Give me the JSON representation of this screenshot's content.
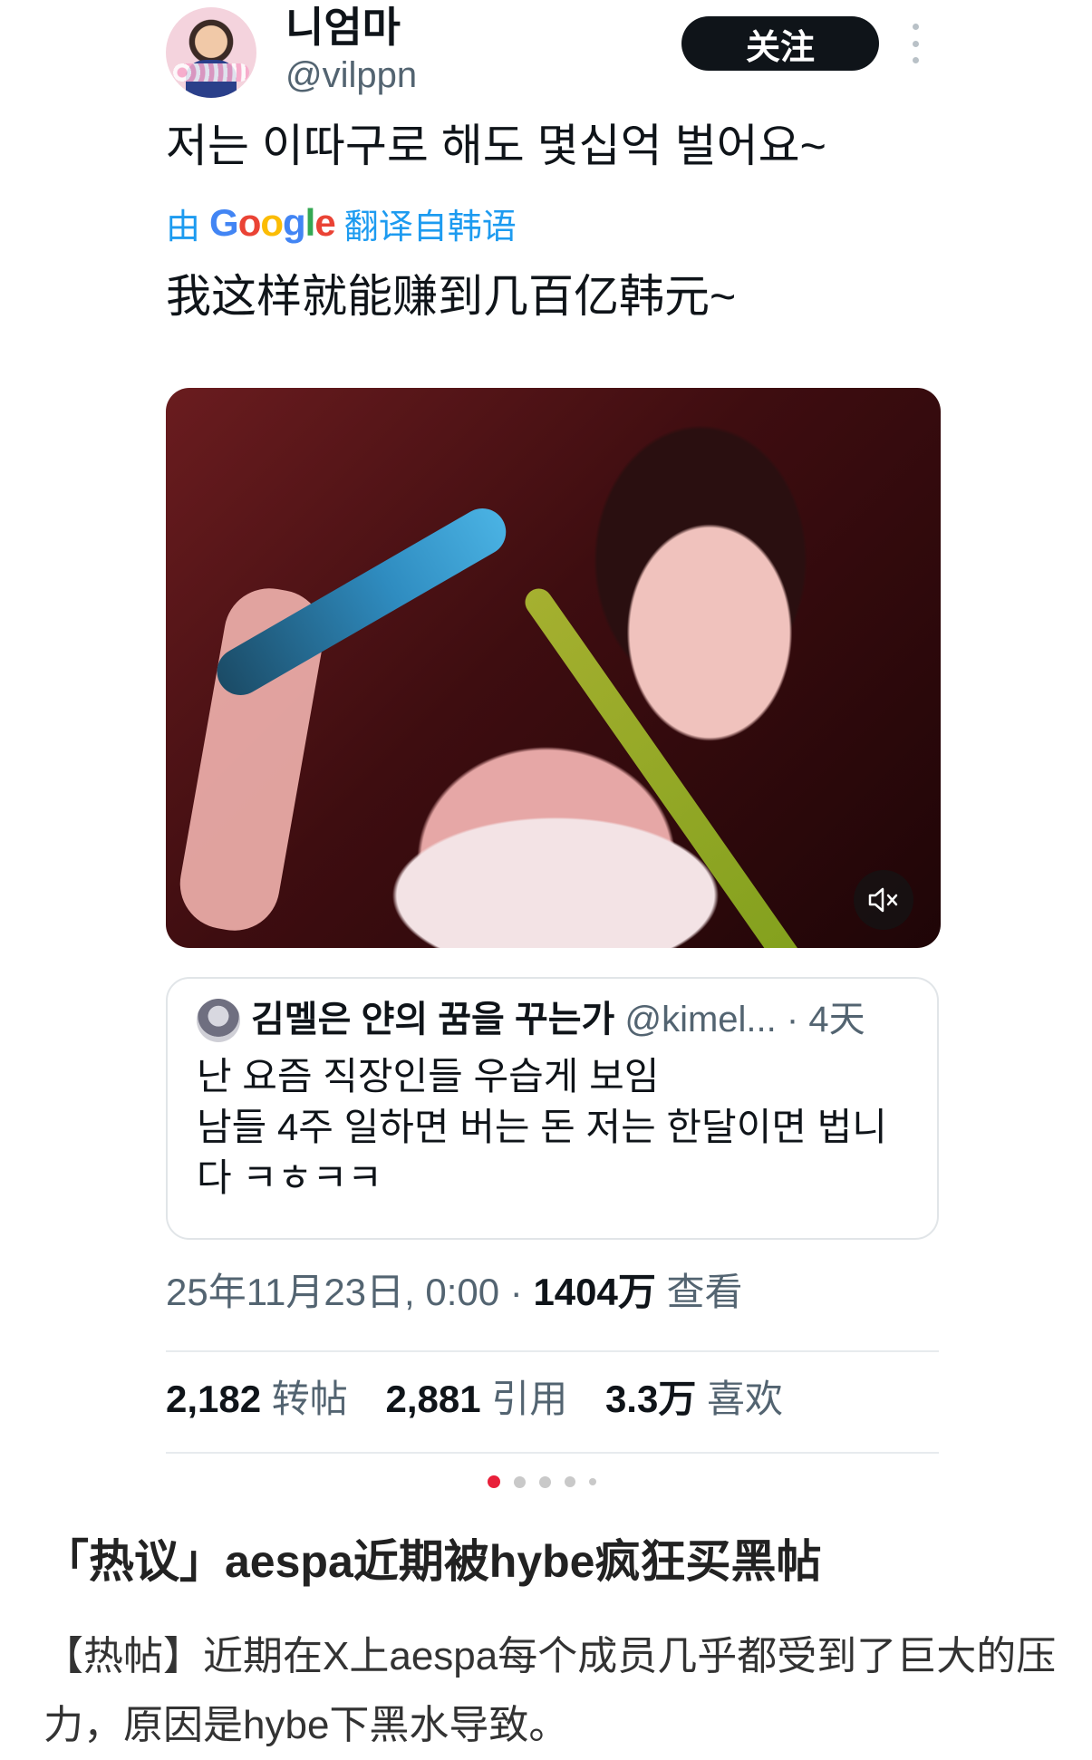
{
  "post": {
    "display_name": "니엄마",
    "handle": "@vilppn",
    "follow_label": "关注",
    "text": "저는 이따구로 해도 몇십억 벌어요~",
    "translation": {
      "prefix": "由",
      "google": "Google",
      "suffix": "翻译自韩语",
      "text": "我这样就能赚到几百亿韩元~"
    }
  },
  "quote": {
    "name": "김멜은 얀의 꿈을 꾸는가",
    "handle": "@kimel...",
    "time": "· 4天",
    "lines": [
      "난 요즘 직장인들 우습게 보임",
      "남들 4주 일하면 버는 돈 저는 한달이면 법니",
      "다 ㅋㅎㅋㅋ"
    ]
  },
  "meta": {
    "date": "25年11月23日, 0:00 · ",
    "views": "1404万",
    "views_label": " 查看"
  },
  "stats": {
    "retweets": "2,182",
    "retweets_label": "转帖",
    "quotes": "2,881",
    "quotes_label": "引用",
    "likes": "3.3万",
    "likes_label": "喜欢"
  },
  "carousel": {
    "count": 5,
    "active": 0,
    "active_color": "#e8203a"
  },
  "article": {
    "title": "「热议」aespa近期被hybe疯狂买黑帖",
    "body": "【热帖】近期在X上aespa每个成员几乎都受到了巨大的压力，原因是hybe下黑水导致。"
  },
  "icons": {
    "more": "more-vertical-icon",
    "mute": "speaker-muted-icon"
  }
}
